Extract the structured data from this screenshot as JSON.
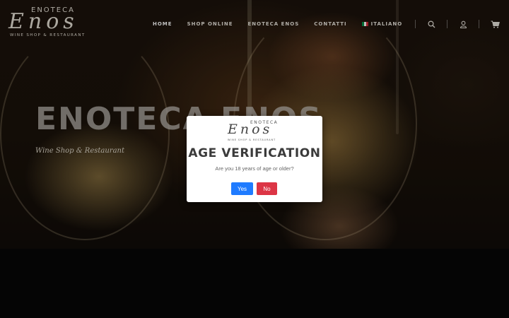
{
  "header": {
    "logo": {
      "top": "ENOTECA",
      "main": "Enos",
      "sub": "WINE SHOP & RESTAURANT"
    },
    "nav": [
      {
        "label": "HOME",
        "active": true
      },
      {
        "label": "SHOP ONLINE",
        "active": false
      },
      {
        "label": "ENOTECA ENOS",
        "active": false
      },
      {
        "label": "CONTATTI",
        "active": false
      },
      {
        "label": "ITALIANO",
        "active": false,
        "flag": [
          "#009246",
          "#ffffff",
          "#ce2b37"
        ]
      }
    ],
    "icons": [
      "search-icon",
      "user-icon",
      "cart-icon"
    ]
  },
  "hero": {
    "title": "ENOTECA ENOS",
    "subtitle": "Wine Shop & Restaurant"
  },
  "modal": {
    "logo": {
      "top": "ENOTECA",
      "main": "Enos",
      "sub": "WINE SHOP & RESTAURANT"
    },
    "title": "AGE VERIFICATION",
    "question": "Are you 18 years of age or older?",
    "yes_label": "Yes",
    "no_label": "No",
    "colors": {
      "yes": "#1f7bff",
      "no": "#dc3545"
    }
  }
}
